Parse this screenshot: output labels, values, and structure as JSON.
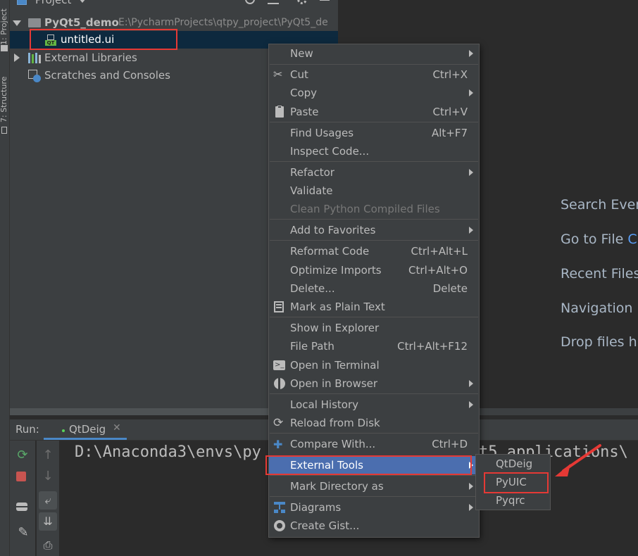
{
  "sidebar": {
    "project_tab": "1: Project",
    "structure_tab": "7: Structure"
  },
  "project_panel": {
    "title": "Project",
    "root_name": "PyQt5_demo",
    "root_path": "E:\\PycharmProjects\\qtpy_project\\PyQt5_de",
    "file_name": "untitled.ui",
    "file_icon_text": "QT",
    "external_libraries": "External Libraries",
    "scratches": "Scratches and Consoles"
  },
  "editor_hints": [
    "Search Ever",
    "Go to File",
    "Recent Files",
    "Navigation",
    "Drop files h"
  ],
  "run_panel": {
    "label": "Run:",
    "tab_name": "QtDeig",
    "console_text": "D:\\Anaconda3\\envs\\py",
    "console_text_tail": "t5_applications\\"
  },
  "context_menu": {
    "items": [
      {
        "label": "New",
        "shortcut": "",
        "submenu": true
      },
      {
        "label": "Cut",
        "shortcut": "Ctrl+X",
        "submenu": false,
        "icon": "scissors-icon"
      },
      {
        "label": "Copy",
        "shortcut": "",
        "submenu": true
      },
      {
        "label": "Paste",
        "shortcut": "Ctrl+V",
        "submenu": false,
        "icon": "clipboard-icon"
      },
      {
        "label": "Find Usages",
        "shortcut": "Alt+F7",
        "submenu": false
      },
      {
        "label": "Inspect Code...",
        "shortcut": "",
        "submenu": false
      },
      {
        "label": "Refactor",
        "shortcut": "",
        "submenu": true
      },
      {
        "label": "Validate",
        "shortcut": "",
        "submenu": false
      },
      {
        "label": "Clean Python Compiled Files",
        "shortcut": "",
        "submenu": false,
        "disabled": true
      },
      {
        "label": "Add to Favorites",
        "shortcut": "",
        "submenu": true
      },
      {
        "label": "Reformat Code",
        "shortcut": "Ctrl+Alt+L",
        "submenu": false
      },
      {
        "label": "Optimize Imports",
        "shortcut": "Ctrl+Alt+O",
        "submenu": false
      },
      {
        "label": "Delete...",
        "shortcut": "Delete",
        "submenu": false
      },
      {
        "label": "Mark as Plain Text",
        "shortcut": "",
        "submenu": false,
        "icon": "plain-text-icon"
      },
      {
        "label": "Show in Explorer",
        "shortcut": "",
        "submenu": false
      },
      {
        "label": "File Path",
        "shortcut": "Ctrl+Alt+F12",
        "submenu": false
      },
      {
        "label": "Open in Terminal",
        "shortcut": "",
        "submenu": false,
        "icon": "terminal-icon"
      },
      {
        "label": "Open in Browser",
        "shortcut": "",
        "submenu": true,
        "icon": "globe-icon"
      },
      {
        "label": "Local History",
        "shortcut": "",
        "submenu": true
      },
      {
        "label": "Reload from Disk",
        "shortcut": "",
        "submenu": false,
        "icon": "reload-icon"
      },
      {
        "label": "Compare With...",
        "shortcut": "Ctrl+D",
        "submenu": false,
        "icon": "compare-icon"
      },
      {
        "label": "External Tools",
        "shortcut": "",
        "submenu": true,
        "highlighted": true
      },
      {
        "label": "Mark Directory as",
        "shortcut": "",
        "submenu": true
      },
      {
        "label": "Diagrams",
        "shortcut": "",
        "submenu": true,
        "icon": "diagram-icon"
      },
      {
        "label": "Create Gist...",
        "shortcut": "",
        "submenu": false,
        "icon": "github-icon"
      }
    ]
  },
  "submenu": {
    "items": [
      "QtDeig",
      "PyUIC",
      "Pyqrc"
    ]
  },
  "colors": {
    "highlight": "#4b6eaf",
    "annotation": "#e53935",
    "background": "#2b2b2b",
    "panel": "#3c3f41"
  }
}
